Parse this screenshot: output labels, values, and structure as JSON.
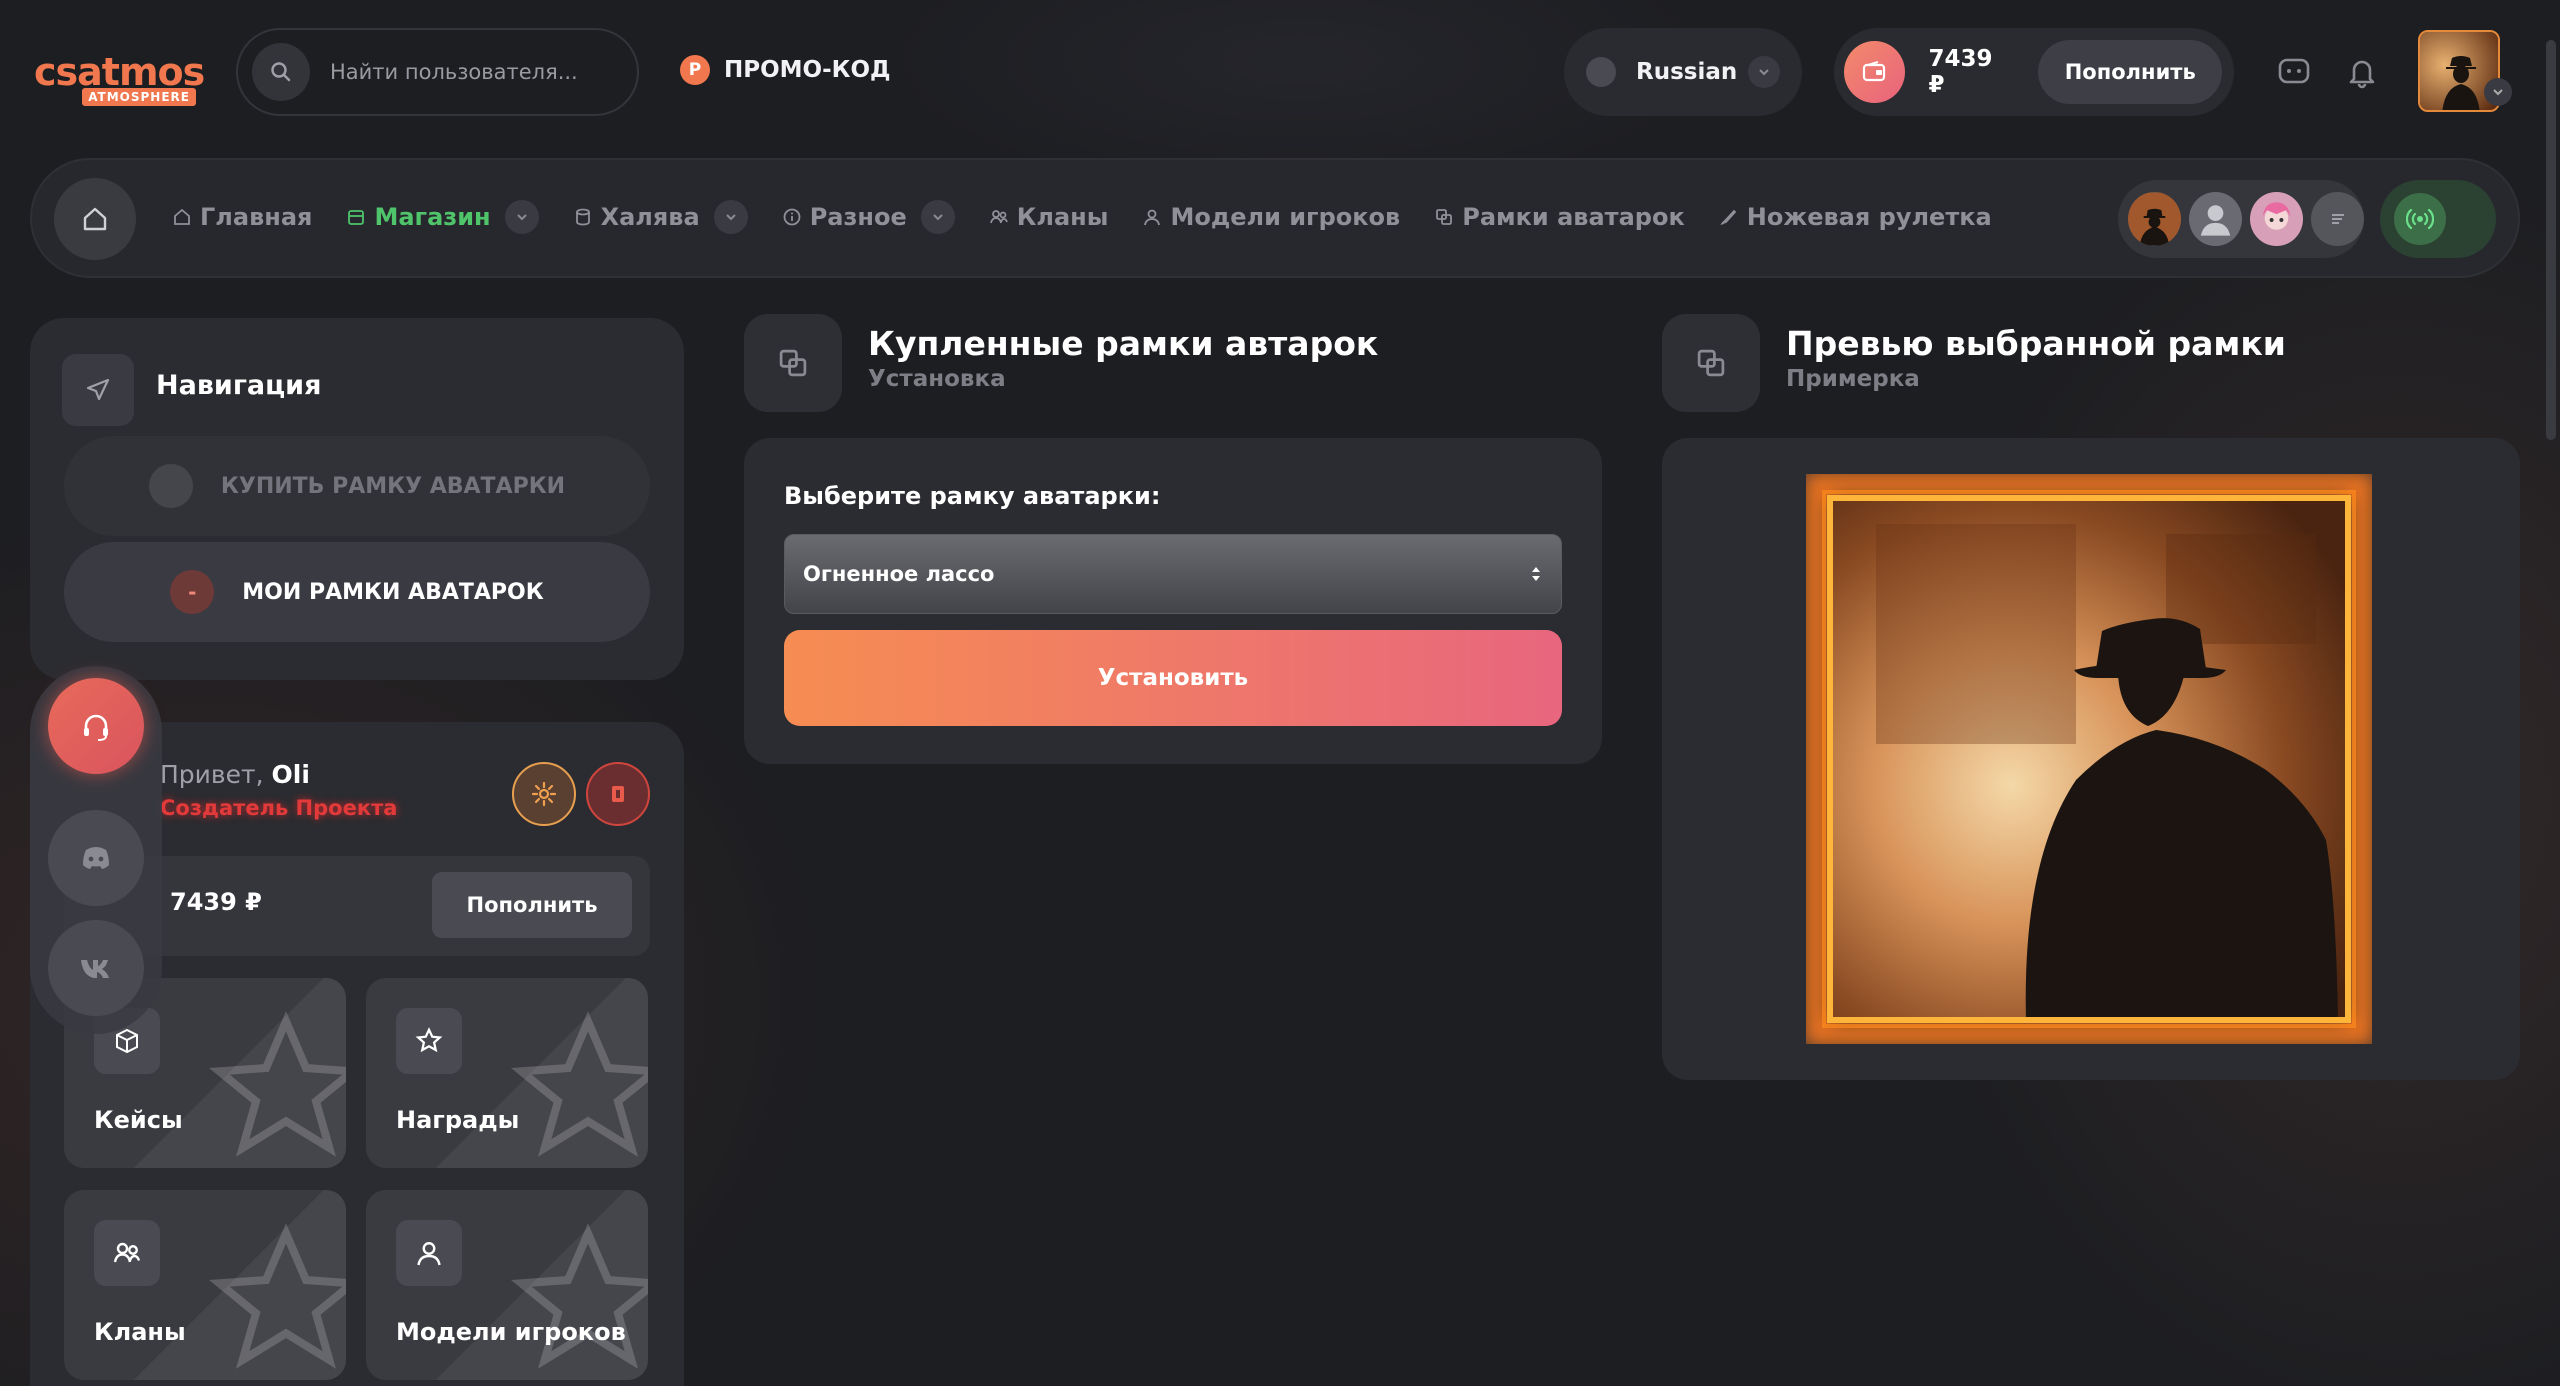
{
  "header": {
    "logo_main": "csatmos",
    "logo_sub": "ATMOSPHERE",
    "search_placeholder": "Найти пользователя...",
    "promo_badge": "P",
    "promo_label": "ПРОМО-КОД",
    "language": "Russian",
    "balance": "7439 ₽",
    "topup_label": "Пополнить"
  },
  "nav": {
    "items": [
      {
        "label": "Главная"
      },
      {
        "label": "Магазин"
      },
      {
        "label": "Халява"
      },
      {
        "label": "Разное"
      },
      {
        "label": "Кланы"
      },
      {
        "label": "Модели игроков"
      },
      {
        "label": "Рамки аватарок"
      },
      {
        "label": "Ножевая рулетка"
      }
    ]
  },
  "sidebar": {
    "nav_title": "Навигация",
    "buy_frame": "КУПИТЬ РАМКУ АВАТАРКИ",
    "my_frames": "МОИ РАМКИ АВАТАРОК",
    "my_frames_badge": "-",
    "hello_prefix": "Привет,",
    "username": "Oli",
    "role": "Создатель Проекта",
    "balance": "7439 ₽",
    "topup_label": "Пополнить",
    "tiles": [
      {
        "label": "Кейсы"
      },
      {
        "label": "Награды"
      },
      {
        "label": "Кланы"
      },
      {
        "label": "Модели игроков"
      }
    ]
  },
  "purchased": {
    "title": "Купленные рамки автарок",
    "subtitle": "Установка",
    "select_label": "Выберите рамку аватарки:",
    "selected_frame": "Огненное лассо",
    "install_label": "Установить"
  },
  "preview": {
    "title": "Превью выбранной рамки",
    "subtitle": "Примерка"
  },
  "colors": {
    "accent": "#f0774e",
    "active_nav": "#4fc46a",
    "install_gradient_start": "#f68d52",
    "install_gradient_end": "#e8667e",
    "role_red": "#e23a3a"
  }
}
